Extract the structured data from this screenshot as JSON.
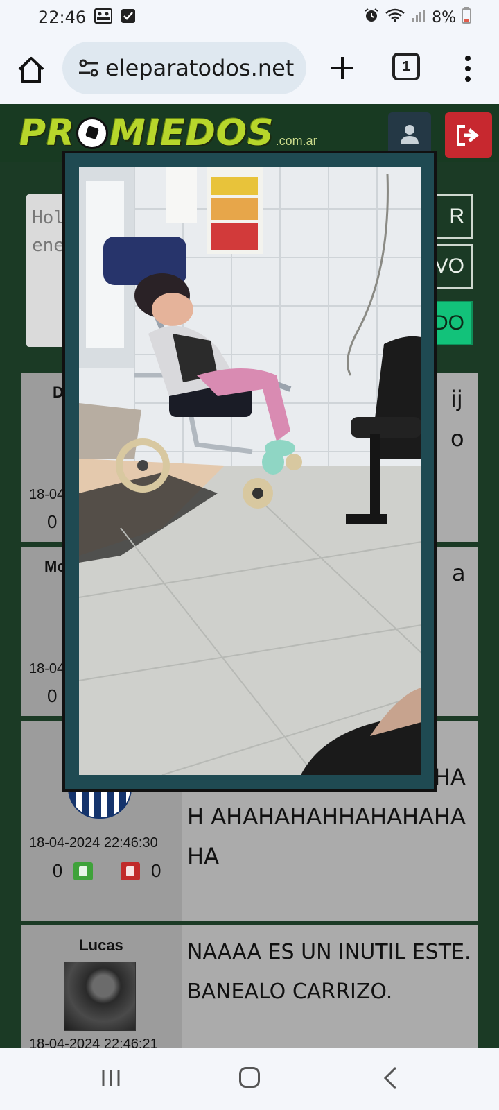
{
  "status_bar": {
    "time": "22:46",
    "battery": "8%"
  },
  "browser": {
    "url": "eleparatodos.net",
    "tab_count": "1"
  },
  "site": {
    "logo_main": "PROMIEDOS",
    "logo_ball_letter": "O",
    "logo_suffix": ".com.ar"
  },
  "chat_input": {
    "value": "Hol\nene"
  },
  "side_buttons": [
    "R",
    "VO",
    "DO"
  ],
  "posts": [
    {
      "username": "D",
      "date": "18-04",
      "up_votes": "0",
      "down_votes": "",
      "message": "ijo"
    },
    {
      "username": "Mo",
      "date": "18-04",
      "up_votes": "0",
      "down_votes": "",
      "message": "a"
    },
    {
      "username": "",
      "date": "18-04-2024 22:46:30",
      "up_votes": "0",
      "down_votes": "0",
      "message": "AH AHAHAHHAHAHAHHAH AHAHAHAHHAHAHAHA HA"
    },
    {
      "username": "Lucas",
      "date": "18-04-2024 22:46:21",
      "up_votes": "",
      "down_votes": "",
      "message": "NAAAA ES UN INUTIL ESTE. BANEALO CARRIZO."
    }
  ],
  "colors": {
    "page_bg": "#1b3a25",
    "header_bg": "#183a22",
    "logo_green": "#b7d62b",
    "logout_red": "#c7282f",
    "modal_frame": "#1f4a52",
    "vote_up": "#3fa23a",
    "vote_down": "#c12a2a"
  }
}
